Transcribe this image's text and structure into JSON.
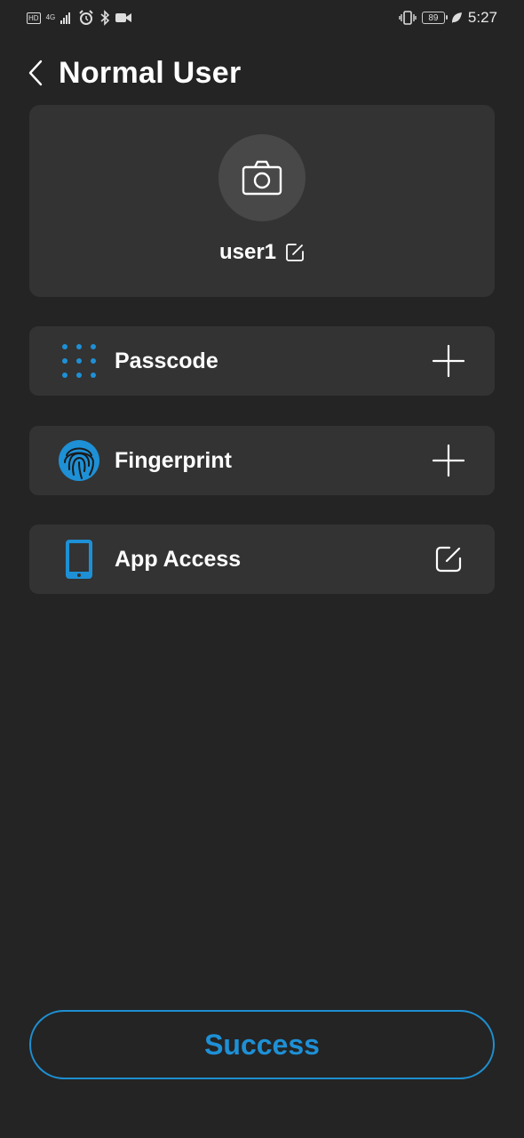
{
  "status_bar": {
    "hd": "HD",
    "network": "4G",
    "battery": "89",
    "time": "5:27"
  },
  "header": {
    "title": "Normal User"
  },
  "profile": {
    "username": "user1"
  },
  "items": [
    {
      "label": "Passcode",
      "icon": "keypad-icon",
      "action": "add-icon"
    },
    {
      "label": "Fingerprint",
      "icon": "fingerprint-icon",
      "action": "add-icon"
    },
    {
      "label": "App Access",
      "icon": "phone-icon",
      "action": "edit-icon"
    }
  ],
  "success_button": {
    "label": "Success"
  },
  "colors": {
    "accent": "#1E90D6",
    "background": "#242424",
    "card": "#333333"
  }
}
